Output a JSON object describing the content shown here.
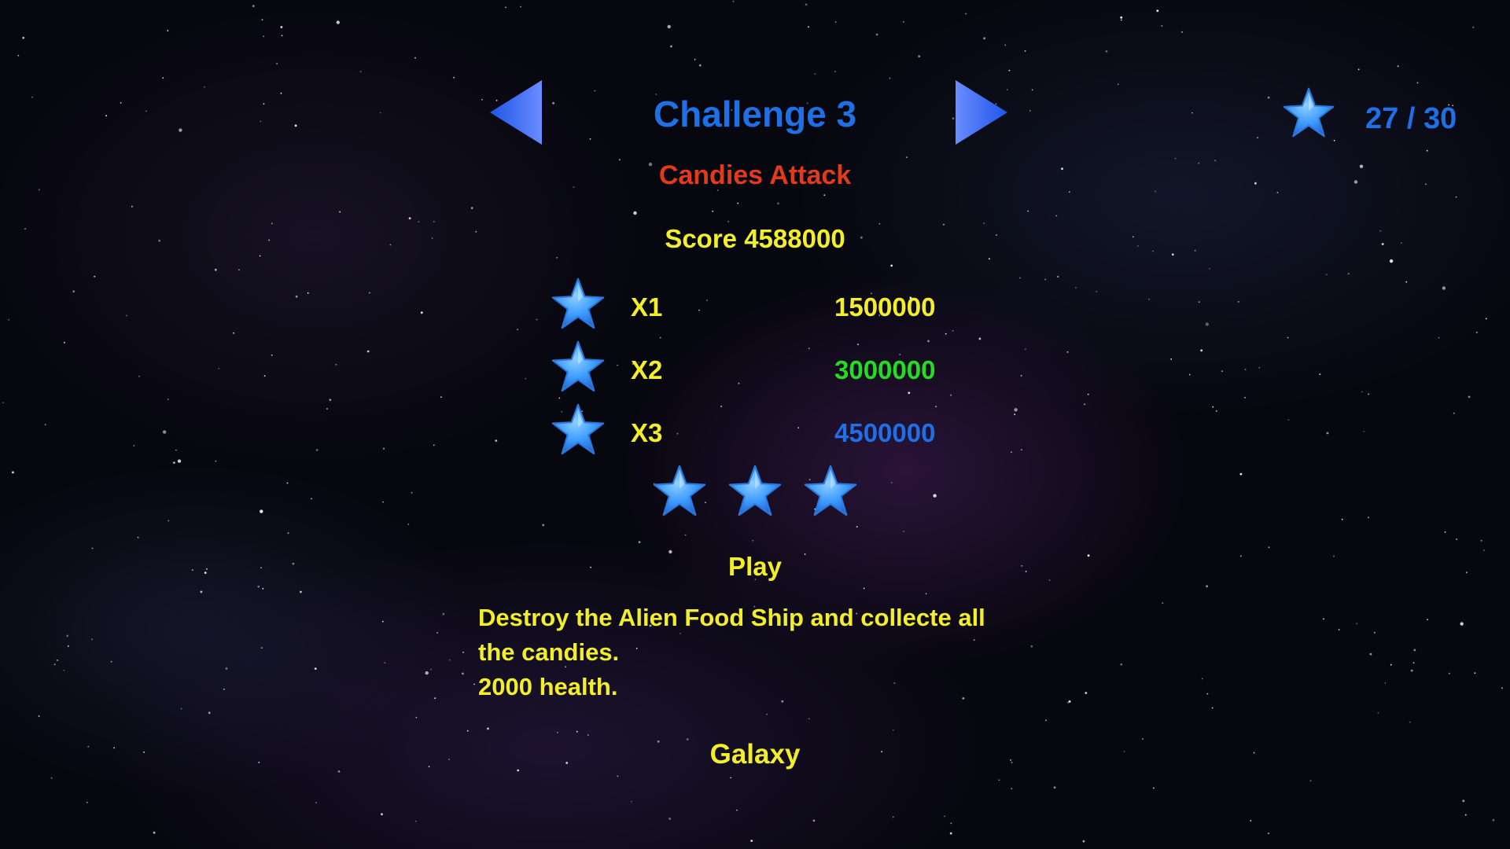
{
  "header": {
    "title": "Challenge 3",
    "subtitle": "Candies Attack",
    "score_text": "Score 4588000"
  },
  "stars_total": {
    "text": "27 / 30",
    "icon": "star-icon"
  },
  "tiers": [
    {
      "label": "X1",
      "value": "1500000",
      "color": "#f2ef2a"
    },
    {
      "label": "X2",
      "value": "3000000",
      "color": "#22dd22"
    },
    {
      "label": "X3",
      "value": "4500000",
      "color": "#1f6fe6"
    }
  ],
  "earned_stars": 3,
  "play_label": "Play",
  "description": {
    "line1": "Destroy the Alien Food Ship and collecte all",
    "line2": "the candies.",
    "line3": "2000 health."
  },
  "galaxy_label": "Galaxy",
  "colors": {
    "star": "#3d9bff",
    "arrow": "#2f62ea",
    "title": "#1f6fe6",
    "subtitle": "#e43a1c",
    "text": "#f2ef2a"
  }
}
